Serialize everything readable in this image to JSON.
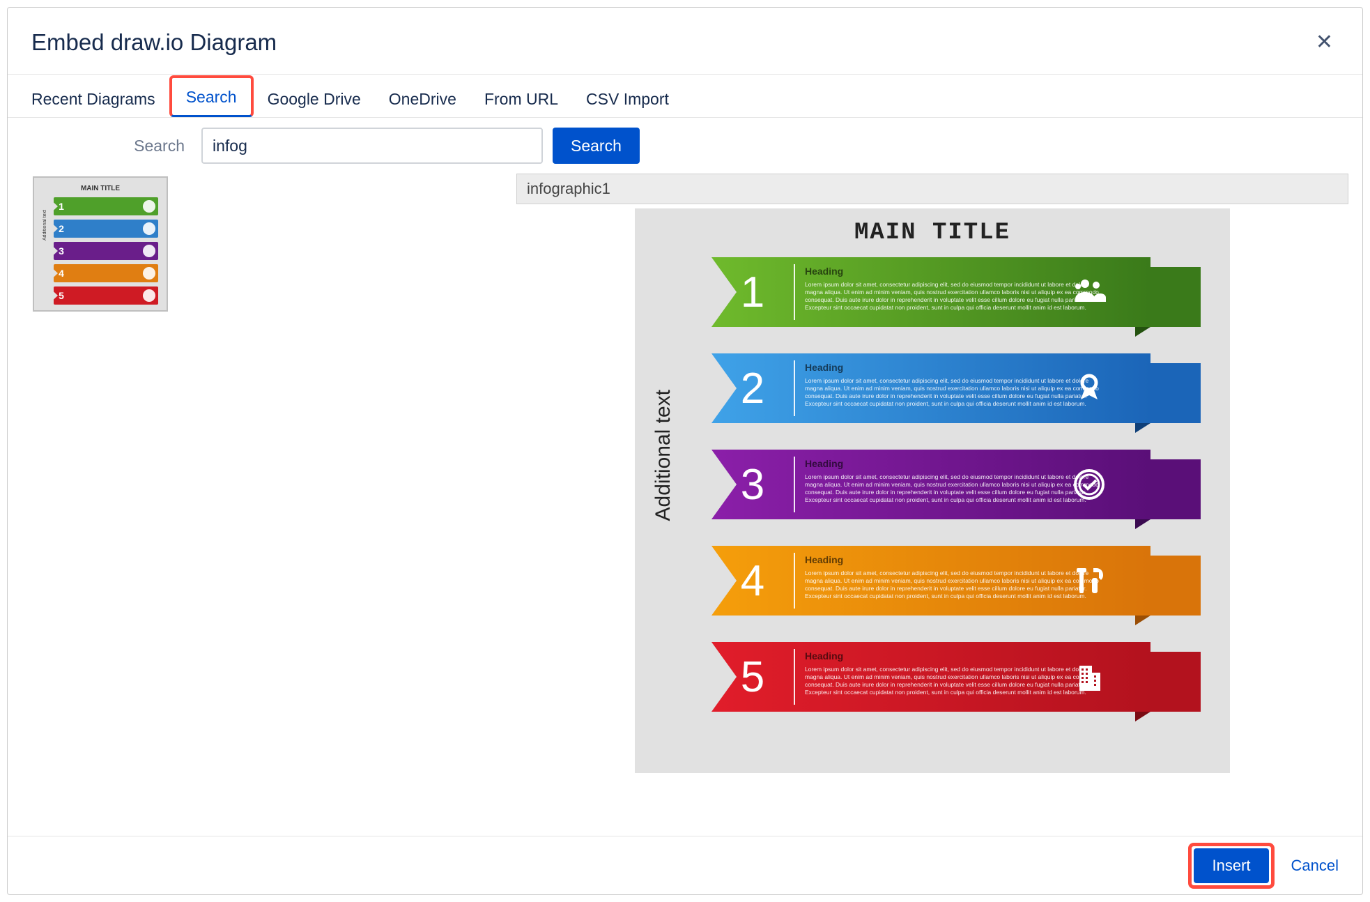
{
  "dialog": {
    "title": "Embed draw.io Diagram"
  },
  "tabs": [
    {
      "label": "Recent Diagrams",
      "active": false,
      "highlight": false
    },
    {
      "label": "Search",
      "active": true,
      "highlight": true
    },
    {
      "label": "Google Drive",
      "active": false,
      "highlight": false
    },
    {
      "label": "OneDrive",
      "active": false,
      "highlight": false
    },
    {
      "label": "From URL",
      "active": false,
      "highlight": false
    },
    {
      "label": "CSV Import",
      "active": false,
      "highlight": false
    }
  ],
  "search": {
    "label": "Search",
    "value": "infog",
    "button": "Search"
  },
  "thumbnail": {
    "title": "MAIN TITLE",
    "side": "Additional text"
  },
  "preview": {
    "name": "infographic1",
    "title": "MAIN TITLE",
    "side": "Additional text",
    "lorem": "Lorem ipsum dolor sit amet, consectetur adipiscing elit, sed do eiusmod tempor incididunt ut labore et dolore magna aliqua. Ut enim ad minim veniam, quis nostrud exercitation ullamco laboris nisi ut aliquip ex ea commodo consequat. Duis aute irure dolor in reprehenderit in voluptate velit esse cillum dolore eu fugiat nulla pariatur. Excepteur sint occaecat cupidatat non proident, sunt in culpa qui officia deserunt mollit anim id est laborum.",
    "bands": [
      {
        "num": "1",
        "heading": "Heading",
        "color": "green",
        "icon": "people-icon"
      },
      {
        "num": "2",
        "heading": "Heading",
        "color": "blue",
        "icon": "ribbon-icon"
      },
      {
        "num": "3",
        "heading": "Heading",
        "color": "purple",
        "icon": "check-icon"
      },
      {
        "num": "4",
        "heading": "Heading",
        "color": "orange",
        "icon": "tools-icon"
      },
      {
        "num": "5",
        "heading": "Heading",
        "color": "red",
        "icon": "building-icon"
      }
    ]
  },
  "footer": {
    "insert": "Insert",
    "cancel": "Cancel",
    "insert_highlight": true
  }
}
